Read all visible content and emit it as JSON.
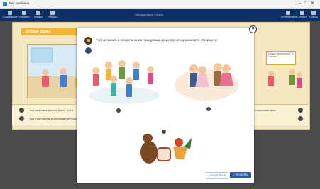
{
  "window": {
    "title": "Бит учебника"
  },
  "toolbar": {
    "center_text": "Официалната страна",
    "items": [
      "Съдържание",
      "Указания",
      "Книжки",
      "Тетрадка"
    ],
    "right_items": [
      "Интерактивни",
      "Профил",
      "Помощ"
    ]
  },
  "book": {
    "header": "Отвори шарен",
    "card_text": "\"Стари лятна песен\" Б. Сказово",
    "bottom_lines": [
      "Кой изпълнява песента „Жълт“. Кой е.",
      "Кой и кой чувства от инструментите разказват с тях."
    ],
    "bottom_lines_right": [
      "Чуй, кой изпълнява песен",
      "Кои са..."
    ]
  },
  "modal": {
    "instruction": "Чуй музиката и сподели за кои танцуващи деца звучат музикантите. Свържи ги.",
    "reset_label": "↺ ИЗЧИСТВАНЕ",
    "check_label": "✔ ПРОВЕРКА"
  },
  "colors": {
    "toolbar": "#0c2f66",
    "accent": "#f3b43a",
    "primary": "#2b57a4",
    "bg": "#4a4a4a"
  },
  "icons": [
    "close-icon",
    "speaker-icon",
    "microphone-icon"
  ]
}
